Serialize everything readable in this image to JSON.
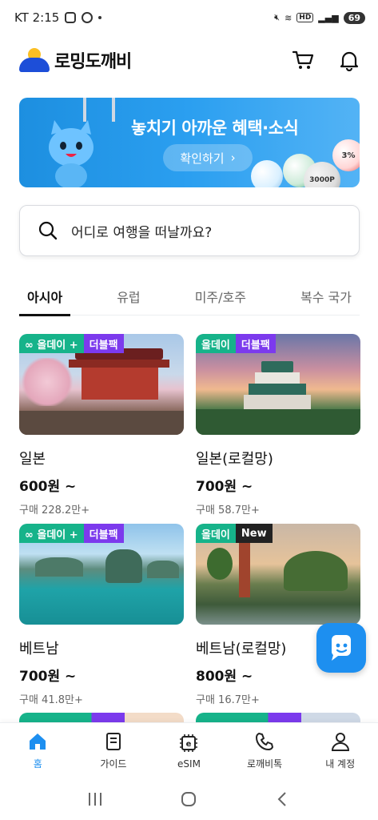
{
  "status_bar": {
    "carrier_time": "KT 2:15",
    "network": "HD",
    "battery": "69"
  },
  "header": {
    "logo_text": "로밍도깨비",
    "cart_icon": "cart-icon",
    "bell_icon": "bell-icon"
  },
  "banner": {
    "title": "놓치기 아까운 혜택·소식",
    "cta": "확인하기",
    "cta_arrow": "›",
    "ball_label_1": "3000P",
    "ball_label_2": "3%"
  },
  "search": {
    "placeholder": "어디로 여행을 떠날까요?"
  },
  "tabs": [
    {
      "label": "아시아",
      "active": true
    },
    {
      "label": "유럽",
      "active": false
    },
    {
      "label": "미주/호주",
      "active": false
    },
    {
      "label": "복수 국가",
      "active": false
    }
  ],
  "products": [
    {
      "badges": [
        "∞ 올데이 +",
        "더블팩"
      ],
      "name": "일본",
      "price": "600원 ~",
      "sold": "구매 228.2만+"
    },
    {
      "badges": [
        "올데이",
        "더블팩"
      ],
      "name": "일본(로컬망)",
      "price": "700원 ~",
      "sold": "구매 58.7만+"
    },
    {
      "badges": [
        "∞ 올데이 +",
        "더블팩"
      ],
      "name": "베트남",
      "price": "700원 ~",
      "sold": "구매 41.8만+"
    },
    {
      "badges": [
        "올데이",
        "New"
      ],
      "name": "베트남(로컬망)",
      "price": "800원 ~",
      "sold": "구매 16.7만+"
    }
  ],
  "bottom_nav": [
    {
      "label": "홈",
      "icon": "home-icon",
      "active": true
    },
    {
      "label": "가이드",
      "icon": "book-icon",
      "active": false
    },
    {
      "label": "eSIM",
      "icon": "esim-icon",
      "active": false
    },
    {
      "label": "로깨비톡",
      "icon": "phone-icon",
      "active": false
    },
    {
      "label": "내 계정",
      "icon": "user-icon",
      "active": false
    }
  ],
  "colors": {
    "brand_blue": "#1d8ff0",
    "allday_green": "#16b38a",
    "double_purple": "#7c3aed"
  }
}
